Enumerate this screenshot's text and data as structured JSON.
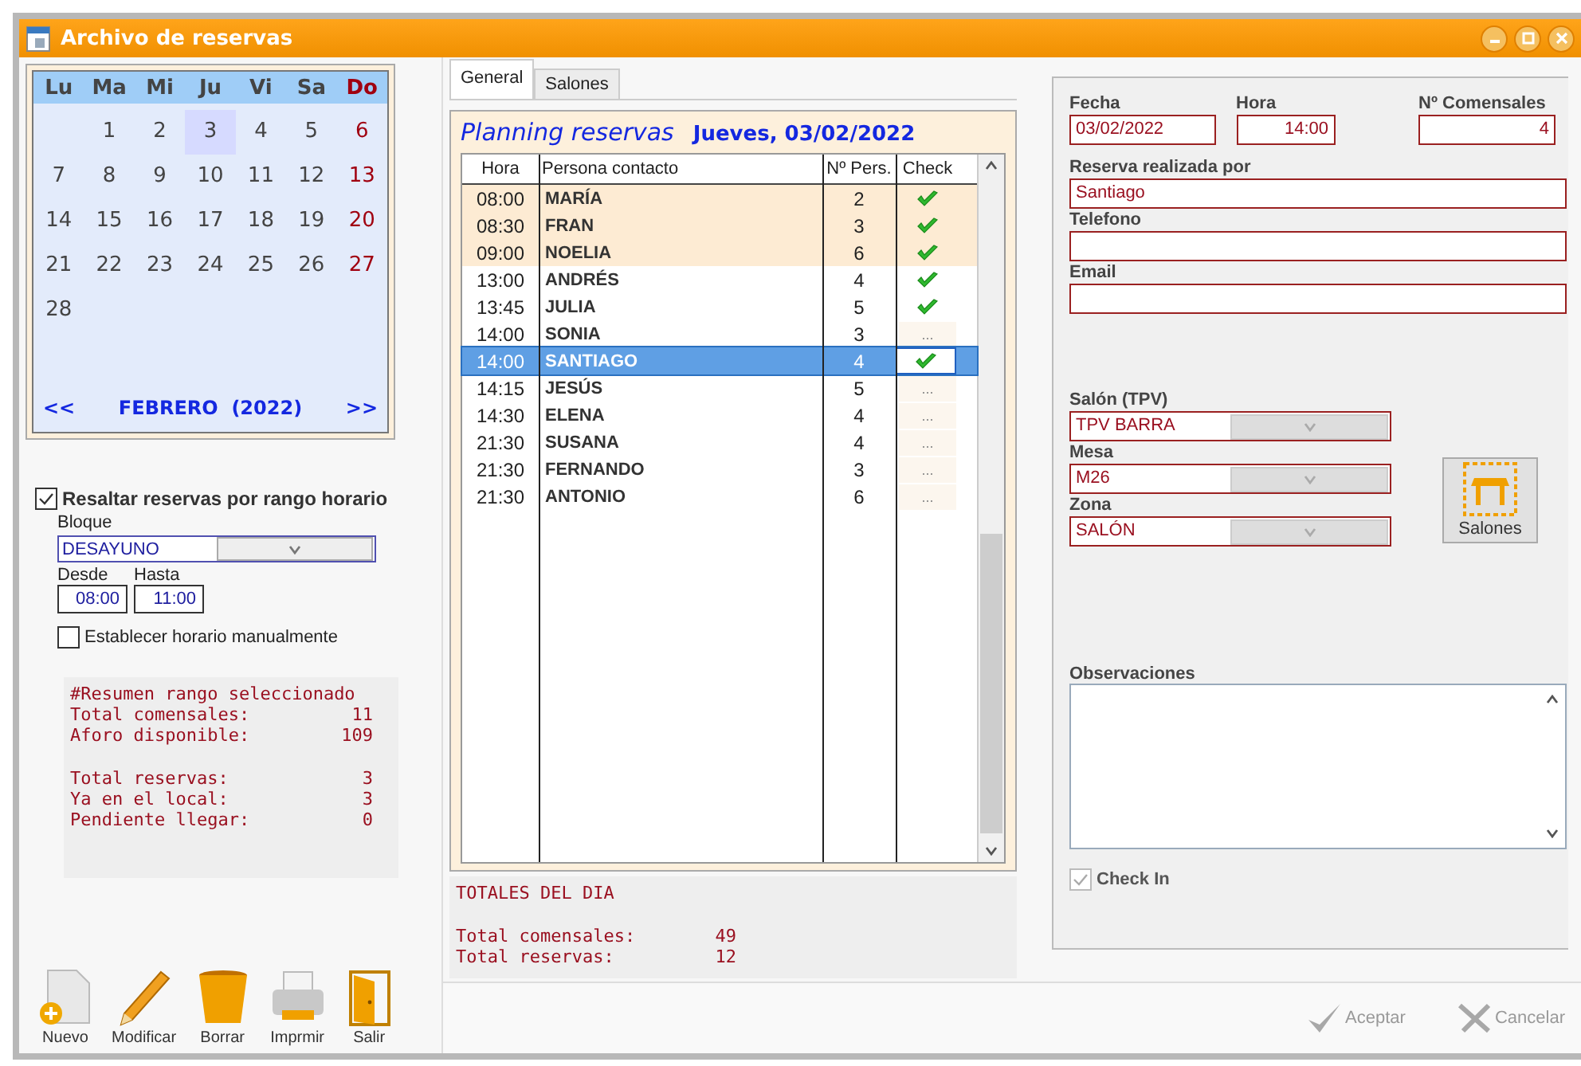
{
  "window": {
    "title": "Archivo de reservas"
  },
  "calendar": {
    "weekdays": [
      {
        "label": "Lu",
        "holiday": false
      },
      {
        "label": "Ma",
        "holiday": false
      },
      {
        "label": "Mi",
        "holiday": false
      },
      {
        "label": "Ju",
        "holiday": false
      },
      {
        "label": "Vi",
        "holiday": false
      },
      {
        "label": "Sa",
        "holiday": false
      },
      {
        "label": "Do",
        "holiday": true
      }
    ],
    "weeks": [
      {
        "kind": "end",
        "days": [
          {
            "day": "1",
            "holiday": false,
            "selected": false
          },
          {
            "day": "2",
            "holiday": false,
            "selected": false
          },
          {
            "day": "3",
            "holiday": false,
            "selected": true
          },
          {
            "day": "4",
            "holiday": false,
            "selected": false
          },
          {
            "day": "5",
            "holiday": false,
            "selected": false
          },
          {
            "day": "6",
            "holiday": true,
            "selected": false
          }
        ]
      },
      {
        "kind": "full",
        "days": [
          {
            "day": "7",
            "holiday": false,
            "selected": false
          },
          {
            "day": "8",
            "holiday": false,
            "selected": false
          },
          {
            "day": "9",
            "holiday": false,
            "selected": false
          },
          {
            "day": "10",
            "holiday": false,
            "selected": false
          },
          {
            "day": "11",
            "holiday": false,
            "selected": false
          },
          {
            "day": "12",
            "holiday": false,
            "selected": false
          },
          {
            "day": "13",
            "holiday": true,
            "selected": false
          }
        ]
      },
      {
        "kind": "full",
        "days": [
          {
            "day": "14",
            "holiday": false,
            "selected": false
          },
          {
            "day": "15",
            "holiday": false,
            "selected": false
          },
          {
            "day": "16",
            "holiday": false,
            "selected": false
          },
          {
            "day": "17",
            "holiday": false,
            "selected": false
          },
          {
            "day": "18",
            "holiday": false,
            "selected": false
          },
          {
            "day": "19",
            "holiday": false,
            "selected": false
          },
          {
            "day": "20",
            "holiday": true,
            "selected": false
          }
        ]
      },
      {
        "kind": "full",
        "days": [
          {
            "day": "21",
            "holiday": false,
            "selected": false
          },
          {
            "day": "22",
            "holiday": false,
            "selected": false
          },
          {
            "day": "23",
            "holiday": false,
            "selected": false
          },
          {
            "day": "24",
            "holiday": false,
            "selected": false
          },
          {
            "day": "25",
            "holiday": false,
            "selected": false
          },
          {
            "day": "26",
            "holiday": false,
            "selected": false
          },
          {
            "day": "27",
            "holiday": true,
            "selected": false
          }
        ]
      },
      {
        "kind": "start",
        "days": [
          {
            "day": "28",
            "holiday": false,
            "selected": false
          }
        ]
      }
    ],
    "prev": "<<",
    "month": "FEBRERO  (2022)",
    "next": ">>"
  },
  "range_filter": {
    "highlight": {
      "label": "Resaltar reservas por rango horario",
      "checked": true
    },
    "block_label": "Bloque",
    "block_value": "DESAYUNO",
    "from_label": "Desde",
    "from_value": "08:00",
    "to_label": "Hasta",
    "to_value": "11:00",
    "manual": {
      "label": "Establecer horario manualmente",
      "checked": false
    }
  },
  "range_summary": {
    "title": "#Resumen rango seleccionado",
    "lines": [
      {
        "label": "Total comensales:",
        "value": "11",
        "group_start": false
      },
      {
        "label": "Aforo disponible:",
        "value": "109",
        "group_start": false
      },
      {
        "label": "Total reservas:",
        "value": "3",
        "group_start": true
      },
      {
        "label": "Ya en el local:",
        "value": "3",
        "group_start": false
      },
      {
        "label": "Pendiente llegar:",
        "value": "0",
        "group_start": false
      }
    ]
  },
  "toolbar": [
    {
      "kind": "new",
      "label": "Nuevo"
    },
    {
      "kind": "edit",
      "label": "Modificar"
    },
    {
      "kind": "delete",
      "label": "Borrar"
    },
    {
      "kind": "print",
      "label": "Imprmir"
    },
    {
      "kind": "exit",
      "label": "Salir"
    }
  ],
  "tabs": [
    {
      "label": "General",
      "selected": true
    },
    {
      "label": "Salones",
      "selected": false
    }
  ],
  "planning": {
    "title": "Planning reservas",
    "date": "Jueves, 03/02/2022",
    "columns": [
      "Hora",
      "Persona contacto",
      "Nº Pers.",
      "Check"
    ],
    "rows": [
      {
        "time": "08:00",
        "person": "MARÍA",
        "people": "2",
        "checked": true,
        "highlighted": true,
        "selected": false
      },
      {
        "time": "08:30",
        "person": "FRAN",
        "people": "3",
        "checked": true,
        "highlighted": true,
        "selected": false
      },
      {
        "time": "09:00",
        "person": "NOELIA",
        "people": "6",
        "checked": true,
        "highlighted": true,
        "selected": false
      },
      {
        "time": "13:00",
        "person": "ANDRÉS",
        "people": "4",
        "checked": true,
        "highlighted": false,
        "selected": false
      },
      {
        "time": "13:45",
        "person": "JULIA",
        "people": "5",
        "checked": true,
        "highlighted": false,
        "selected": false
      },
      {
        "time": "14:00",
        "person": "SONIA",
        "people": "3",
        "checked": false,
        "button": "...",
        "highlighted": false,
        "selected": false
      },
      {
        "time": "14:00",
        "person": "SANTIAGO",
        "people": "4",
        "checked": true,
        "highlighted": false,
        "selected": true
      },
      {
        "time": "14:15",
        "person": "JESÚS",
        "people": "5",
        "checked": false,
        "button": "...",
        "highlighted": false,
        "selected": false
      },
      {
        "time": "14:30",
        "person": "ELENA",
        "people": "4",
        "checked": false,
        "button": "...",
        "highlighted": false,
        "selected": false
      },
      {
        "time": "21:30",
        "person": "SUSANA",
        "people": "4",
        "checked": false,
        "button": "...",
        "highlighted": false,
        "selected": false
      },
      {
        "time": "21:30",
        "person": "FERNANDO",
        "people": "3",
        "checked": false,
        "button": "...",
        "highlighted": false,
        "selected": false
      },
      {
        "time": "21:30",
        "person": "ANTONIO",
        "people": "6",
        "checked": false,
        "button": "...",
        "highlighted": false,
        "selected": false
      }
    ]
  },
  "day_totals": {
    "title": "TOTALES DEL DIA",
    "lines": [
      {
        "label": "Total comensales:",
        "value": "49"
      },
      {
        "label": "Total reservas:",
        "value": "12"
      }
    ]
  },
  "form": {
    "date": {
      "label": "Fecha",
      "value": "03/02/2022"
    },
    "time": {
      "label": "Hora",
      "value": "14:00"
    },
    "guests": {
      "label": "Nº Comensales",
      "value": "4"
    },
    "booked_by": {
      "label": "Reserva realizada por",
      "value": "Santiago"
    },
    "phone": {
      "label": "Telefono"
    },
    "email": {
      "label": "Email"
    },
    "selects": [
      {
        "label": "Salón (TPV)",
        "value": "TPV BARRA"
      },
      {
        "label": "Mesa",
        "value": "M26"
      },
      {
        "label": "Zona",
        "value": "SALÓN"
      }
    ],
    "rooms_button": "Salones",
    "notes_label": "Observaciones",
    "check_in": {
      "label": "Check In",
      "checked": true,
      "disabled": true
    }
  },
  "actions": [
    {
      "kind": "accept",
      "label": "Aceptar",
      "disabled": true
    },
    {
      "kind": "cancel",
      "label": "Cancelar",
      "disabled": true
    }
  ]
}
